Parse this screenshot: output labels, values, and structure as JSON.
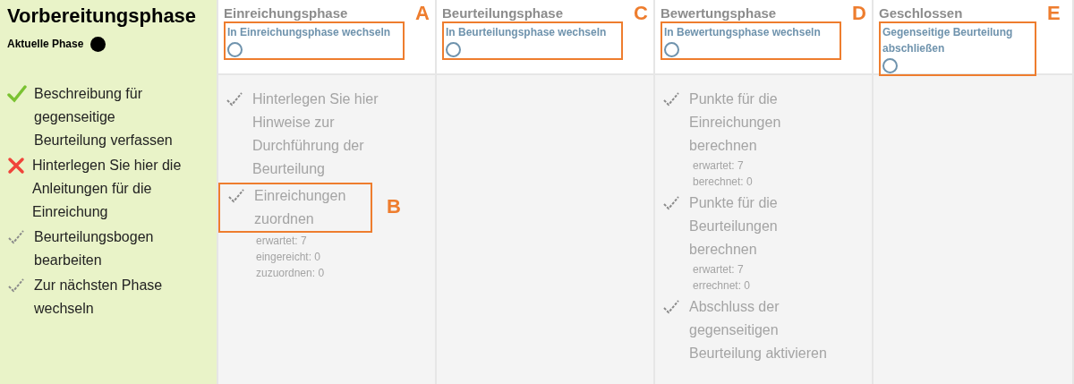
{
  "phases": [
    {
      "title": "Vorbereitungsphase",
      "current": true,
      "current_label": "Aktuelle Phase",
      "tasks": [
        {
          "label": "Beschreibung für gegenseitige Beurteilung verfassen",
          "kind": "done"
        },
        {
          "label": "Hinterlegen Sie hier die Anleitungen für die Einreichung",
          "kind": "failed"
        },
        {
          "label": "Beurteilungsbogen bearbeiten",
          "kind": "todo"
        },
        {
          "label": "Zur nächsten Phase wechseln",
          "kind": "todo"
        }
      ]
    },
    {
      "title": "Einreichungsphase",
      "current": false,
      "switch": {
        "label": "In Einreichungsphase wechseln",
        "callout": "A"
      },
      "tasks": [
        {
          "label": "Hinterlegen Sie hier Hinweise zur Durchführung der Beurteilung",
          "kind": "todo"
        },
        {
          "label": "Einreichungen zuordnen",
          "kind": "todo",
          "callout": "B",
          "details": [
            "erwartet: 7",
            "eingereicht: 0",
            "zuzuordnen: 0"
          ]
        }
      ]
    },
    {
      "title": "Beurteilungsphase",
      "current": false,
      "switch": {
        "label": "In Beurteilungsphase wechseln",
        "callout": "C"
      }
    },
    {
      "title": "Bewertungsphase",
      "current": false,
      "switch": {
        "label": "In Bewertungsphase wechseln",
        "callout": "D"
      },
      "tasks": [
        {
          "label": "Punkte für die Einreichungen berechnen",
          "kind": "todo",
          "details": [
            "erwartet: 7",
            "berechnet: 0"
          ]
        },
        {
          "label": "Punkte für die Beurteilungen berechnen",
          "kind": "todo",
          "details": [
            "erwartet: 7",
            "errechnet: 0"
          ]
        },
        {
          "label": "Abschluss der gegenseitigen Beurteilung aktivieren",
          "kind": "todo"
        }
      ]
    },
    {
      "title": "Geschlossen",
      "current": false,
      "switch": {
        "label": "Gegenseitige Beurteilung abschließen",
        "callout": "E"
      }
    }
  ]
}
